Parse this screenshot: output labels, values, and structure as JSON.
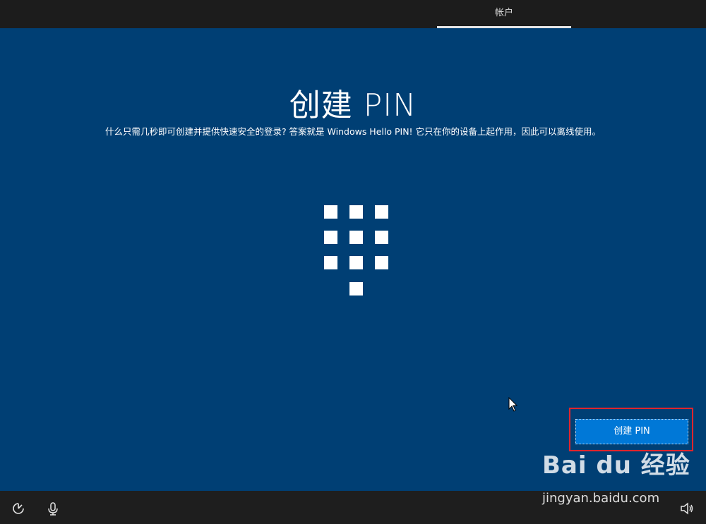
{
  "header": {
    "tab_label": "帐户"
  },
  "main": {
    "title": "创建 PIN",
    "description": "什么只需几秒即可创建并提供快速安全的登录? 答案就是 Windows Hello PIN! 它只在你的设备上起作用，因此可以离线使用。",
    "keypad_icon": "pin-keypad-icon",
    "create_button_label": "创建 PIN"
  },
  "footer": {
    "icons": [
      "ease-of-access-icon",
      "microphone-icon",
      "volume-icon"
    ]
  },
  "watermark": {
    "logo_text": "Bai du 经验",
    "url": "jingyan.baidu.com"
  },
  "colors": {
    "panel_bg": "#003f74",
    "button_bg": "#0078d7",
    "highlight_frame": "#e0252c"
  }
}
